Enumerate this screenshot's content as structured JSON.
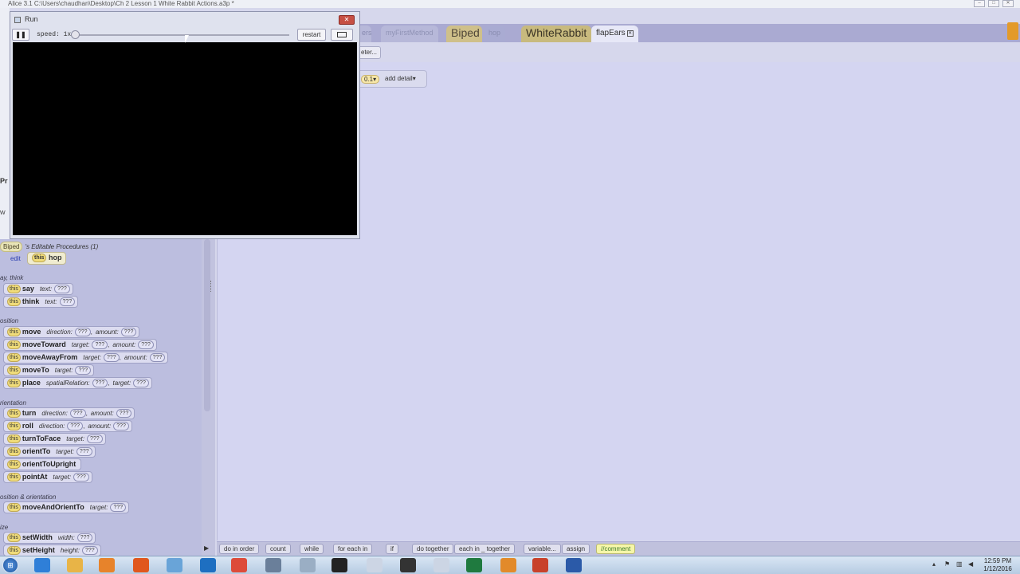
{
  "app": {
    "title": "Alice 3.1 C:\\Users\\chaudhan\\Desktop\\Ch 2 Lesson 1 White Rabbit Actions.a3p *",
    "controls": [
      "–",
      "□",
      "✕"
    ]
  },
  "tabs": [
    {
      "label": "ers"
    },
    {
      "label": "myFirstMethod"
    },
    {
      "label": "Biped"
    },
    {
      "label": "hop"
    },
    {
      "label": "WhiteRabbit"
    },
    {
      "label": "flapEars",
      "close": "✕"
    }
  ],
  "editor": {
    "parameter_button": "eter...",
    "value_chip": "0.1",
    "add_detail": "add detail",
    "dropdown_glyph": "▾"
  },
  "run_window": {
    "title": "Run",
    "pause_glyph": "❚❚",
    "speed_label": "speed: 1x",
    "speed_fraction": 0.0,
    "restart_label": "restart",
    "close_glyph": "✕"
  },
  "palette": {
    "class_chip": "Biped",
    "editable_title": "'s Editable Procedures (1)",
    "edit_label": "edit",
    "this_label": "this",
    "hop_label": "hop",
    "sections": {
      "say_think": "ay, think",
      "position": "osition",
      "orientation": "rientation",
      "position_orientation": "osition & orientation",
      "size": "ize"
    },
    "procedures": [
      {
        "name": "say",
        "params": [
          {
            "name": "text:",
            "value": "???"
          }
        ]
      },
      {
        "name": "think",
        "params": [
          {
            "name": "text:",
            "value": "???"
          }
        ]
      },
      {
        "name": "move",
        "params": [
          {
            "name": "direction:",
            "value": "???"
          },
          {
            "name": "amount:",
            "value": "???"
          }
        ]
      },
      {
        "name": "moveToward",
        "params": [
          {
            "name": "target:",
            "value": "???"
          },
          {
            "name": "amount:",
            "value": "???"
          }
        ]
      },
      {
        "name": "moveAwayFrom",
        "params": [
          {
            "name": "target:",
            "value": "???"
          },
          {
            "name": "amount:",
            "value": "???"
          }
        ]
      },
      {
        "name": "moveTo",
        "params": [
          {
            "name": "target:",
            "value": "???"
          }
        ]
      },
      {
        "name": "place",
        "params": [
          {
            "name": "spatialRelation:",
            "value": "???"
          },
          {
            "name": "target:",
            "value": "???"
          }
        ]
      },
      {
        "name": "turn",
        "params": [
          {
            "name": "direction:",
            "value": "???"
          },
          {
            "name": "amount:",
            "value": "???"
          }
        ]
      },
      {
        "name": "roll",
        "params": [
          {
            "name": "direction:",
            "value": "???"
          },
          {
            "name": "amount:",
            "value": "???"
          }
        ]
      },
      {
        "name": "turnToFace",
        "params": [
          {
            "name": "target:",
            "value": "???"
          }
        ]
      },
      {
        "name": "orientTo",
        "params": [
          {
            "name": "target:",
            "value": "???"
          }
        ]
      },
      {
        "name": "orientToUpright",
        "params": []
      },
      {
        "name": "pointAt",
        "params": [
          {
            "name": "target:",
            "value": "???"
          }
        ]
      },
      {
        "name": "moveAndOrientTo",
        "params": [
          {
            "name": "target:",
            "value": "???"
          }
        ]
      },
      {
        "name": "setWidth",
        "params": [
          {
            "name": "width:",
            "value": "???"
          }
        ]
      },
      {
        "name": "setHeight",
        "params": [
          {
            "name": "height:",
            "value": "???"
          }
        ]
      }
    ]
  },
  "control_bar": [
    "do in order",
    "count",
    "while",
    "for each in",
    "if",
    "do together",
    "each in _ together",
    "variable...",
    "assign",
    "//comment"
  ],
  "behind_window_text": {
    "left_fragment": "Pr",
    "left_fragment2": "W"
  },
  "taskbar": {
    "time": "12:59 PM",
    "date": "1/12/2016",
    "icons": [
      "ie-icon",
      "explorer-icon",
      "media-player-icon",
      "firefox-icon",
      "paint-icon",
      "outlook-icon",
      "chrome-icon",
      "network-icon",
      "settings-icon",
      "cmd-icon",
      "java-icon",
      "obs-icon",
      "java2-icon",
      "excel-icon",
      "alice-icon",
      "powerpoint-icon",
      "word-icon"
    ]
  }
}
